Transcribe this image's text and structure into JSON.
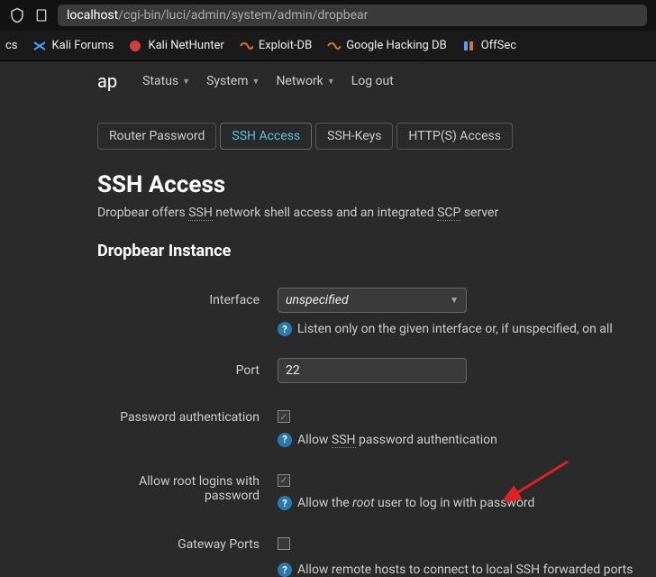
{
  "url": {
    "host": "localhost",
    "path": "/cgi-bin/luci/admin/system/admin/dropbear"
  },
  "bookmarks": [
    "cs",
    "Kali Forums",
    "Kali NetHunter",
    "Exploit-DB",
    "Google Hacking DB",
    "OffSec"
  ],
  "nav": {
    "brand": "ap",
    "items": [
      "Status",
      "System",
      "Network"
    ],
    "logout": "Log out"
  },
  "tabs": [
    "Router Password",
    "SSH Access",
    "SSH-Keys",
    "HTTP(S) Access"
  ],
  "page": {
    "title": "SSH Access",
    "desc_pre": "Dropbear offers ",
    "desc_ssh": "SSH",
    "desc_mid": " network shell access and an integrated ",
    "desc_scp": "SCP",
    "desc_post": " server",
    "section": "Dropbear Instance"
  },
  "fields": {
    "interface": {
      "label": "Interface",
      "value": "unspecified",
      "help": "Listen only on the given interface or, if unspecified, on all"
    },
    "port": {
      "label": "Port",
      "value": "22"
    },
    "password_auth": {
      "label": "Password authentication",
      "checked": true,
      "help_pre": "Allow ",
      "help_ssh": "SSH",
      "help_post": " password authentication"
    },
    "root_login": {
      "label": "Allow root logins with password",
      "checked": true,
      "help_pre": "Allow the ",
      "help_root": "root",
      "help_post": " user to log in with password"
    },
    "gateway": {
      "label": "Gateway Ports",
      "checked": false,
      "help": "Allow remote hosts to connect to local SSH forwarded ports"
    }
  }
}
